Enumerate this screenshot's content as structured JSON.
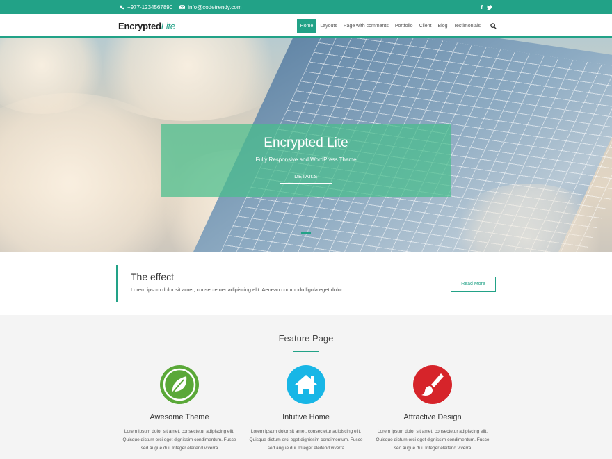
{
  "topbar": {
    "phone": "+977-1234567890",
    "email": "info@codetrendy.com",
    "social": [
      "f",
      "t"
    ]
  },
  "header": {
    "logo_main": "Encrypted",
    "logo_accent": "Lite",
    "nav": [
      "Home",
      "Layouts",
      "Page with comments",
      "Portfolio",
      "Client",
      "Blog",
      "Testimonials"
    ],
    "active_nav": "Home"
  },
  "hero": {
    "title": "Encrypted Lite",
    "subtitle": "Fully Responsive and WordPress Theme",
    "button": "DETAILS"
  },
  "effect": {
    "title": "The effect",
    "text": "Lorem ipsum dolor sit amet, consectetuer adipiscing elit. Aenean commodo ligula eget dolor.",
    "button": "Read More"
  },
  "features": {
    "title": "Feature Page",
    "items": [
      {
        "name": "Awesome Theme",
        "icon": "leaf-icon",
        "color": "#5aa838",
        "text": "Lorem ipsum dolor sit amet, consectetur adipiscing elit. Quisque dictum orci eget dignissim condimentum. Fusce sed augue dui. Integer eleifend viverra"
      },
      {
        "name": "Intutive Home",
        "icon": "home-icon",
        "color": "#18b6e6",
        "text": "Lorem ipsum dolor sit amet, consectetur adipiscing elit. Quisque dictum orci eget dignissim condimentum. Fusce sed augue dui. Integer eleifend viverra"
      },
      {
        "name": "Attractive Design",
        "icon": "paintbrush-icon",
        "color": "#d6242a",
        "text": "Lorem ipsum dolor sit amet, consectetur adipiscing elit. Quisque dictum orci eget dignissim condimentum. Fusce sed augue dui. Integer eleifend viverra"
      }
    ]
  },
  "colors": {
    "accent": "#22a287"
  }
}
